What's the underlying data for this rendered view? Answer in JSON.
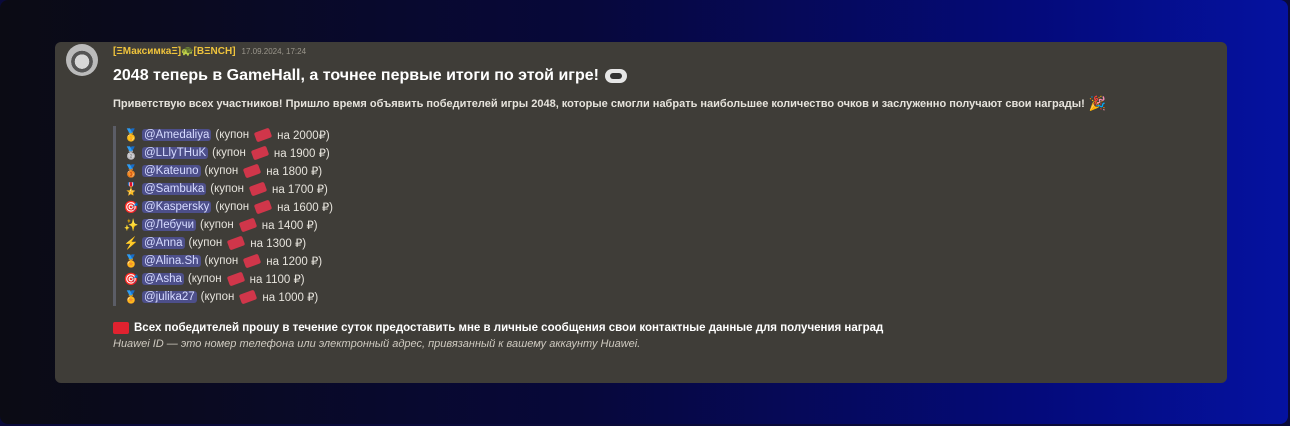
{
  "message": {
    "username": "[ΞМаксимкаΞ]🐢[BΞNCH]",
    "timestamp": "17.09.2024, 17:24",
    "title": "2048 теперь в GameHall, а точнее первые итоги по этой игре!",
    "intro": "Приветствую всех участников! Пришло время объявить победителей игры 2048, которые смогли набрать наибольшее количество очков и заслуженно получают свои награды!",
    "winners": [
      {
        "icon": "gold-medal-icon",
        "glyph": "🥇",
        "mention": "@Amedaliya",
        "prefix": "(купон",
        "suffix": "на 2000₽)"
      },
      {
        "icon": "silver-medal-icon",
        "glyph": "🥈",
        "mention": "@LLlyTHuK",
        "prefix": "(купон",
        "suffix": "на 1900 ₽)"
      },
      {
        "icon": "bronze-medal-icon",
        "glyph": "🥉",
        "mention": "@Kateuno",
        "prefix": "(купон",
        "suffix": "на 1800 ₽)"
      },
      {
        "icon": "medal-icon",
        "glyph": "🎖️",
        "mention": "@Sambuka",
        "prefix": "(купон",
        "suffix": "на 1700 ₽)"
      },
      {
        "icon": "target-icon",
        "glyph": "🎯",
        "mention": "@Kaspersky",
        "prefix": "(купон",
        "suffix": "на 1600 ₽)"
      },
      {
        "icon": "sparkles-icon",
        "glyph": "✨",
        "mention": "@Лебучи",
        "prefix": "(купон",
        "suffix": "на 1400 ₽)"
      },
      {
        "icon": "lightning-icon",
        "glyph": "⚡",
        "mention": "@Anna",
        "prefix": "(купон",
        "suffix": "на 1300 ₽)"
      },
      {
        "icon": "sports-medal-icon",
        "glyph": "🏅",
        "mention": "@Alina.Sh",
        "prefix": "(купон",
        "suffix": "на 1200 ₽)"
      },
      {
        "icon": "target-icon",
        "glyph": "🎯",
        "mention": "@Asha",
        "prefix": "(купон",
        "suffix": "на 1100 ₽)"
      },
      {
        "icon": "sports-medal-icon",
        "glyph": "🏅",
        "mention": "@julika27",
        "prefix": "(купон",
        "suffix": "на 1000 ₽)"
      }
    ],
    "notice": "Всех победителей прошу в течение суток предоставить мне в личные сообщения свои контактные данные для получения наград",
    "note": "Huawei ID — это номер телефона или электронный адрес, привязанный к вашему аккаунту Huawei."
  }
}
